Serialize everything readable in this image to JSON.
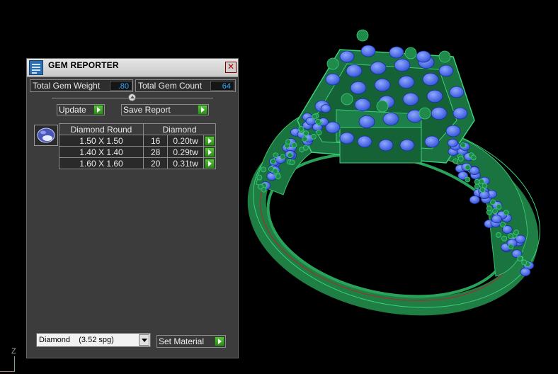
{
  "panel": {
    "title": "GEM REPORTER",
    "close_icon": "close-icon",
    "total_gem_weight_label": "Total Gem Weight",
    "total_gem_weight_value": ".80",
    "total_gem_count_label": "Total Gem Count",
    "total_gem_count_value": "64",
    "update_label": "Update",
    "save_report_label": "Save Report",
    "table": {
      "col_shape": "Diamond Round",
      "col_material": "Diamond",
      "rows": [
        {
          "size": "1.50 X 1.50",
          "count": "16",
          "weight": "0.20tw"
        },
        {
          "size": "1.40 X 1.40",
          "count": "28",
          "weight": "0.29tw"
        },
        {
          "size": "1.60 X 1.60",
          "count": "20",
          "weight": "0.31tw"
        }
      ]
    },
    "material_select_value": "Diamond    (3.52 spg)",
    "set_material_label": "Set Material"
  },
  "viewport": {
    "axis_label": "Z",
    "metal_color": "#1f8a4a",
    "gem_color": "#3f62e0"
  }
}
